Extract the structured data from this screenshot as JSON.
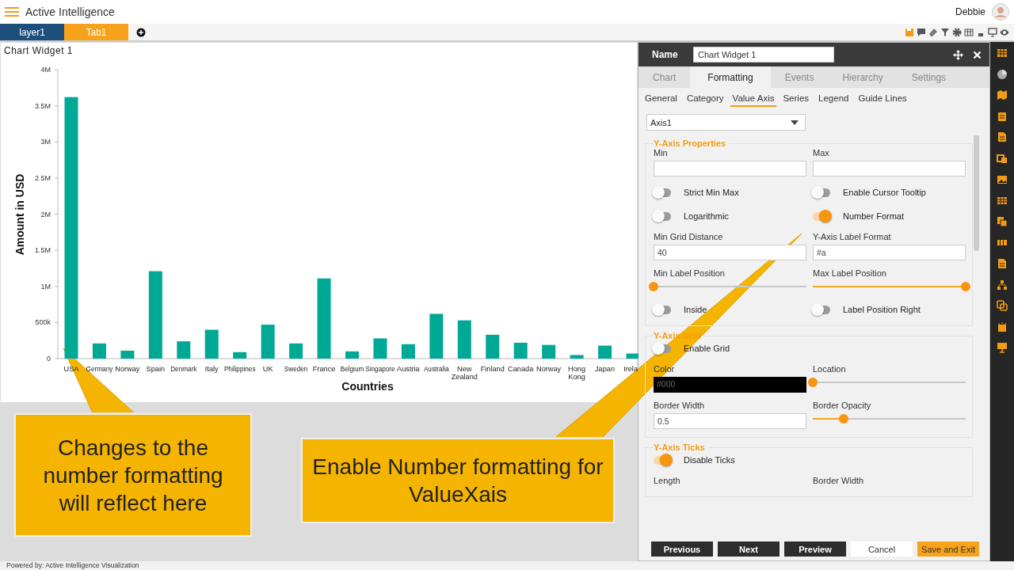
{
  "app": {
    "title": "Active Intelligence",
    "user": "Debbie"
  },
  "tabs": [
    {
      "label": "layer1",
      "selected": false
    },
    {
      "label": "Tab1",
      "selected": true
    }
  ],
  "widget": {
    "title": "Chart Widget 1",
    "chart_data": {
      "type": "bar",
      "xlabel": "Countries",
      "ylabel": "Amount in USD",
      "categories": [
        "USA",
        "Germany",
        "Norway",
        "Spain",
        "Denmark",
        "Italy",
        "Philippines",
        "UK",
        "Sweden",
        "France",
        "Belgium",
        "Singapore",
        "Austria",
        "Australia",
        "New Zealand",
        "Finland",
        "Canada",
        "Norway",
        "Hong Kong",
        "Japan",
        "Irela"
      ],
      "values": [
        3620000,
        210000,
        110000,
        1210000,
        240000,
        400000,
        90000,
        470000,
        210000,
        1110000,
        100000,
        280000,
        200000,
        620000,
        530000,
        330000,
        220000,
        190000,
        50000,
        180000,
        70000
      ],
      "ylim": [
        0,
        4000000
      ],
      "yticks": [
        {
          "value": 0,
          "label": "0"
        },
        {
          "value": 500000,
          "label": "500k"
        },
        {
          "value": 1000000,
          "label": "1M"
        },
        {
          "value": 1500000,
          "label": "1.5M"
        },
        {
          "value": 2000000,
          "label": "2M"
        },
        {
          "value": 2500000,
          "label": "2.5M"
        },
        {
          "value": 3000000,
          "label": "3M"
        },
        {
          "value": 3500000,
          "label": "3.5M"
        },
        {
          "value": 4000000,
          "label": "4M"
        }
      ]
    }
  },
  "panel": {
    "name_label": "Name",
    "name_value": "Chart Widget 1",
    "tabs": [
      {
        "label": "Chart",
        "selected": false
      },
      {
        "label": "Formatting",
        "selected": true
      },
      {
        "label": "Events",
        "selected": false
      },
      {
        "label": "Hierarchy",
        "selected": false
      },
      {
        "label": "Settings",
        "selected": false
      }
    ],
    "subtabs": [
      {
        "label": "General",
        "selected": false
      },
      {
        "label": "Category",
        "selected": false
      },
      {
        "label": "Value Axis",
        "selected": true
      },
      {
        "label": "Series",
        "selected": false
      },
      {
        "label": "Legend",
        "selected": false
      },
      {
        "label": "Guide Lines",
        "selected": false
      }
    ],
    "axis_select": "Axis1",
    "sections": [
      {
        "title": "Y-Axis Properties",
        "rows": [
          [
            {
              "kind": "input",
              "label": "Min"
            },
            {
              "kind": "input",
              "label": "Max"
            }
          ],
          [
            {
              "kind": "toggle",
              "label": "Strict Min Max",
              "on": false
            },
            {
              "kind": "toggle",
              "label": "Enable Cursor Tooltip",
              "on": false
            }
          ],
          [
            {
              "kind": "toggle",
              "label": "Logarithmic",
              "on": false
            },
            {
              "kind": "toggle",
              "label": "Number Format",
              "on": true
            }
          ],
          [
            {
              "kind": "input",
              "label": "Min Grid Distance",
              "value": "40"
            },
            {
              "kind": "input",
              "label": "Y-Axis Label Format",
              "value": "#a"
            }
          ],
          [
            {
              "kind": "slider",
              "label": "Min Label Position",
              "level": 0
            },
            {
              "kind": "slider",
              "label": "Max Label Position",
              "level": 1
            }
          ],
          [
            {
              "kind": "toggle",
              "label": "Inside",
              "on": false
            },
            {
              "kind": "toggle",
              "label": "Label Position Right",
              "on": false
            }
          ]
        ]
      },
      {
        "title": "Y-Axis Grid",
        "rows": [
          [
            {
              "kind": "toggle",
              "label": "Enable Grid",
              "on": false
            }
          ],
          [
            {
              "kind": "color",
              "label": "Color",
              "value": "#000",
              "color": "#000000"
            },
            {
              "kind": "slider",
              "label": "Location",
              "level": 0
            }
          ],
          [
            {
              "kind": "input",
              "label": "Border Width",
              "value": "0.5"
            },
            {
              "kind": "slider",
              "label": "Border Opacity",
              "level": 0.2
            }
          ]
        ]
      },
      {
        "title": "Y-Axis Ticks",
        "rows": [
          [
            {
              "kind": "toggle",
              "label": "Disable Ticks",
              "on": true
            }
          ],
          [
            {
              "kind": "caption",
              "label": "Length"
            },
            {
              "kind": "caption",
              "label": "Border Width"
            }
          ]
        ]
      }
    ],
    "buttons": [
      {
        "label": "Previous",
        "kind": "dark"
      },
      {
        "label": "Next",
        "kind": "dark"
      },
      {
        "label": "Preview",
        "kind": "dark"
      },
      {
        "label": "Cancel",
        "kind": "plain"
      },
      {
        "label": "Save and Exit",
        "kind": "primary"
      }
    ]
  },
  "callouts": [
    {
      "text": "Changes to the number formatting will reflect here"
    },
    {
      "text": "Enable Number formatting for ValueXais"
    }
  ],
  "footer": "Powered by: Active Intelligence Visualization"
}
